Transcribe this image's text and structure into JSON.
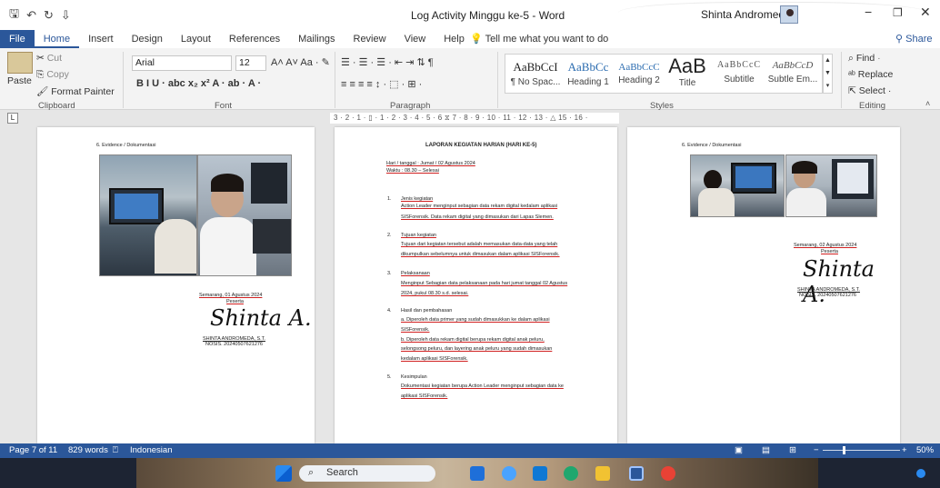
{
  "window": {
    "title": "Log Activity Minggu ke-5  -  Word",
    "user": "Shinta Andromeda",
    "controls": [
      "−",
      "❐",
      "✕"
    ]
  },
  "quick_access": [
    "🖫",
    "↶",
    "↻",
    "⇩"
  ],
  "tabs": [
    "File",
    "Home",
    "Insert",
    "Design",
    "Layout",
    "References",
    "Mailings",
    "Review",
    "View",
    "Help"
  ],
  "tell_me": "Tell me what you want to do",
  "share": "Share",
  "ribbon": {
    "clipboard": {
      "paste": "Paste",
      "cut": "Cut",
      "copy": "Copy",
      "format_painter": "Format Painter",
      "label": "Clipboard"
    },
    "font": {
      "name": "Arial",
      "size": "12",
      "label": "Font",
      "row2": "B  I  U  ·  abc  x₂  x²   A  ·  ab  ·  A  ·"
    },
    "paragraph": {
      "label": "Paragraph",
      "row1": "☰ · ☰ · ☰ ·  ⇤ ⇥  ⇅  ¶",
      "row2": "≡  ≡  ≡  ≡   ↕ ·  ⬚ ·  ⊞ ·"
    },
    "styles": {
      "label": "Styles",
      "items": [
        {
          "sample": "AaBbCcI",
          "name": "¶ No Spac..."
        },
        {
          "sample": "AaBbCc",
          "name": "Heading 1"
        },
        {
          "sample": "AaBbCcC",
          "name": "Heading 2"
        },
        {
          "sample": "AaB",
          "name": "Title"
        },
        {
          "sample": "AaBbCcC",
          "name": "Subtitle"
        },
        {
          "sample": "AaBbCcD",
          "name": "Subtle Em..."
        }
      ]
    },
    "editing": {
      "find": "Find",
      "replace": "Replace",
      "select": "Select",
      "label": "Editing"
    }
  },
  "ruler": "3 · 2 · 1 · ▯ · 1 · 2 · 3 · 4 · 5 · 6 ⧖ 7 · 8 · 9 · 10 · 11 · 12 · 13 · △ 15 · 16 ·",
  "page_left": {
    "heading": "6.   Evidence / Dokumentasi",
    "place_date": "Semarang,     01 Agustus 2024",
    "role": "Peserta",
    "name": "SHINTA ANDROMEDA, S.T.",
    "nosis": "NOSIS. 20240507621276"
  },
  "page_middle": {
    "title": "LAPORAN KEGIATAN HARIAN (HARI KE-5)",
    "date_line": "Hari / tanggal  : Jumat / 02 Agustus 2024",
    "time_line": "Waktu           : 08.30 – Selesai",
    "sections": [
      {
        "num": "1.",
        "head": "Jenis kegiatan",
        "lines": [
          "Action Leader menginput sebagian data rekam digital kedalam aplikasi",
          "SISForensik. Data rekam digital yang dimasukan dari Lapas Slemen."
        ]
      },
      {
        "num": "2.",
        "head": "Tujuan kegiatan",
        "lines": [
          "Tujuan dari kegiatan tersebut adalah memasukan data-data yang telah",
          "dikumpulkan sebelumnya untuk dimasukan dalam aplikasi SISForensik."
        ]
      },
      {
        "num": "3.",
        "head": "Pelaksanaan",
        "lines": [
          "Menginput Sebagian data pelaksanaan pada hari jumat tanggal 02 Agustus",
          "2024, pukul 08.30 s.d. selesai."
        ]
      },
      {
        "num": "4.",
        "head": "Hasil dan pembahasan",
        "lines": [
          "a.  Diperoleh data primer yang sudah dimasukkan ke dalam aplikasi",
          "     SISForensik.",
          "b.  Diperoleh data rekam digital berupa rekam digital anak peluru,",
          "     selongsong peluru, dan layering anak peluru yang sudah dimasukan",
          "     kedalam aplikasi SISForensik."
        ]
      },
      {
        "num": "5.",
        "head": "Kesimpulan",
        "lines": [
          "Dokumentasi kegiatan berupa Action Leader menginput sebagian data ke",
          "aplikasi SISForensik."
        ]
      }
    ]
  },
  "page_right": {
    "heading": "6.   Evidence / Dokumentasi",
    "place_date": "Semarang,     02 Agustus 2024",
    "role": "Peserta",
    "name": "SHINTA ANDROMEDA, S.T.",
    "nosis": "NOSIS. 20240507621276"
  },
  "signature_text": "Shinta A.",
  "status": {
    "page": "Page 7 of 11",
    "words": "829 words",
    "language": "Indonesian",
    "zoom": "50%"
  },
  "taskbar": {
    "search": "Search"
  },
  "colors": {
    "accent": "#2b579a",
    "red_underline": "#d02020"
  }
}
